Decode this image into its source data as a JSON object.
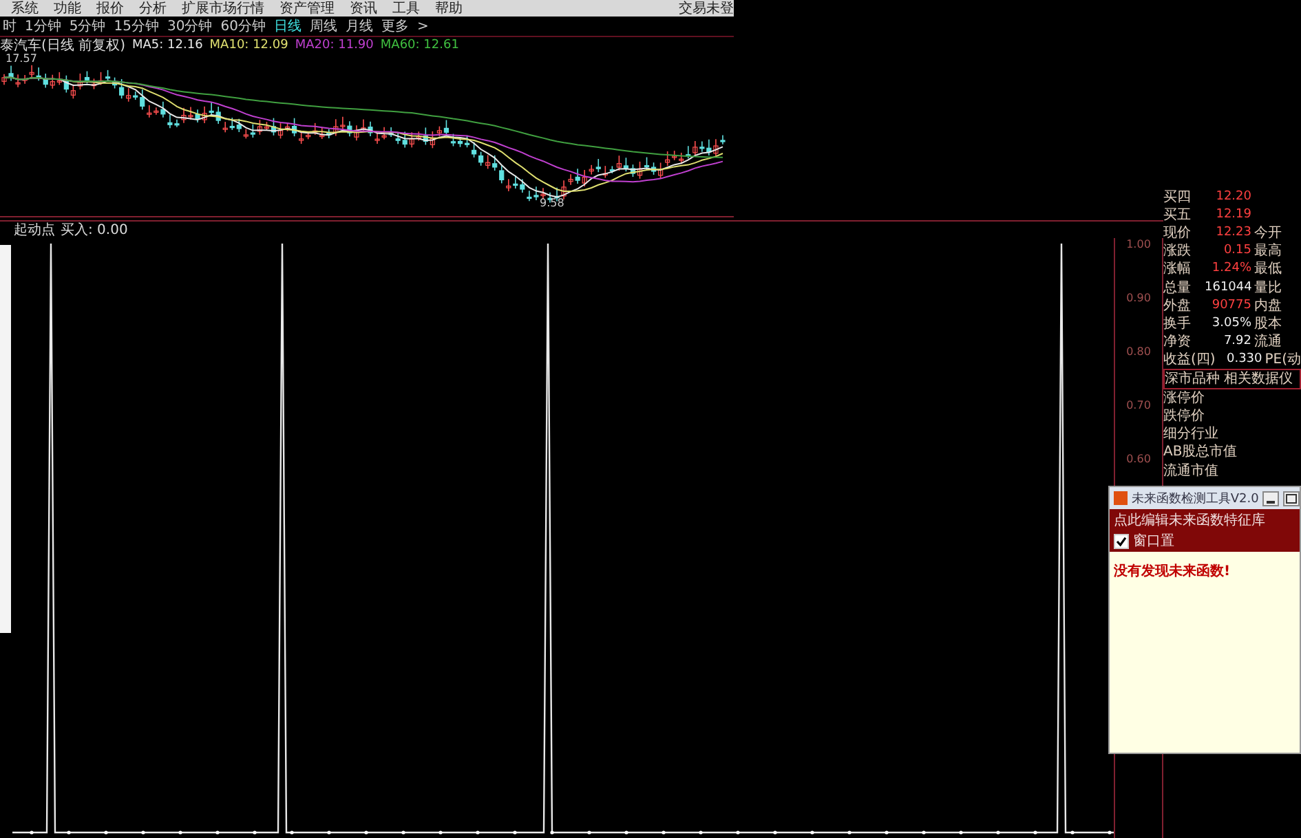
{
  "menu_bar": {
    "items": [
      "系统",
      "功能",
      "报价",
      "分析",
      "扩展市场行情",
      "资产管理",
      "资讯",
      "工具",
      "帮助"
    ],
    "status": "交易未登"
  },
  "period_bar": {
    "items": [
      {
        "label": "时",
        "selected": false
      },
      {
        "label": "1分钟",
        "selected": false
      },
      {
        "label": "5分钟",
        "selected": false
      },
      {
        "label": "15分钟",
        "selected": false
      },
      {
        "label": "30分钟",
        "selected": false
      },
      {
        "label": "60分钟",
        "selected": false
      },
      {
        "label": "日线",
        "selected": true
      },
      {
        "label": "周线",
        "selected": false
      },
      {
        "label": "月线",
        "selected": false
      },
      {
        "label": "更多",
        "selected": false
      },
      {
        "label": ">",
        "selected": false
      }
    ]
  },
  "price_chart": {
    "title": "泰汽车(日线 前复权)",
    "indicators": [
      {
        "label": "MA5: 12.16",
        "color": "#e8e8e8"
      },
      {
        "label": "MA10: 12.09",
        "color": "#e0e070"
      },
      {
        "label": "MA20: 11.90",
        "color": "#c040d0"
      },
      {
        "label": "MA60: 12.61",
        "color": "#40c040"
      }
    ],
    "high_label": "17.57",
    "low_label": "9.58"
  },
  "indicator_panel": {
    "title": "起动点",
    "reading": "买入: 0.00",
    "axis_labels": [
      "1.00",
      "0.90",
      "0.80",
      "0.70",
      "0.60"
    ]
  },
  "quote_panel": {
    "rows": [
      {
        "label": "买四",
        "value": "12.20",
        "rising": true
      },
      {
        "label": "买五",
        "value": "12.19",
        "rising": true
      },
      {
        "label": "现价",
        "value": "12.23",
        "rising": true,
        "label_2": "今开"
      },
      {
        "label": "涨跌",
        "value": "0.15",
        "rising": true,
        "label_2": "最高"
      },
      {
        "label": "涨幅",
        "value": "1.24%",
        "rising": true,
        "label_2": "最低"
      },
      {
        "label": "总量",
        "value": "161044",
        "rising": false,
        "label_2": "量比"
      },
      {
        "label": "外盘",
        "value": "90775",
        "rising": true,
        "label_2": "内盘"
      },
      {
        "label": "换手",
        "value": "3.05%",
        "rising": false,
        "label_2": "股本"
      },
      {
        "label": "净资",
        "value": "7.92",
        "rising": false,
        "label_2": "流通"
      },
      {
        "label": "收益(四)",
        "value": "0.330",
        "rising": false,
        "label_2": "PE(动"
      }
    ],
    "section_title": "深市品种",
    "section_link": "相关数据仪",
    "info_rows": [
      "涨停价",
      "跌停价",
      "细分行业",
      "AB股总市值",
      "流通市值"
    ]
  },
  "popup": {
    "title": "未来函数检测工具V2.0",
    "edit_link": "点此编辑未来函数特征库",
    "pin": {
      "label": "窗口置",
      "checked": true
    },
    "message": "没有发现未来函数!"
  }
}
